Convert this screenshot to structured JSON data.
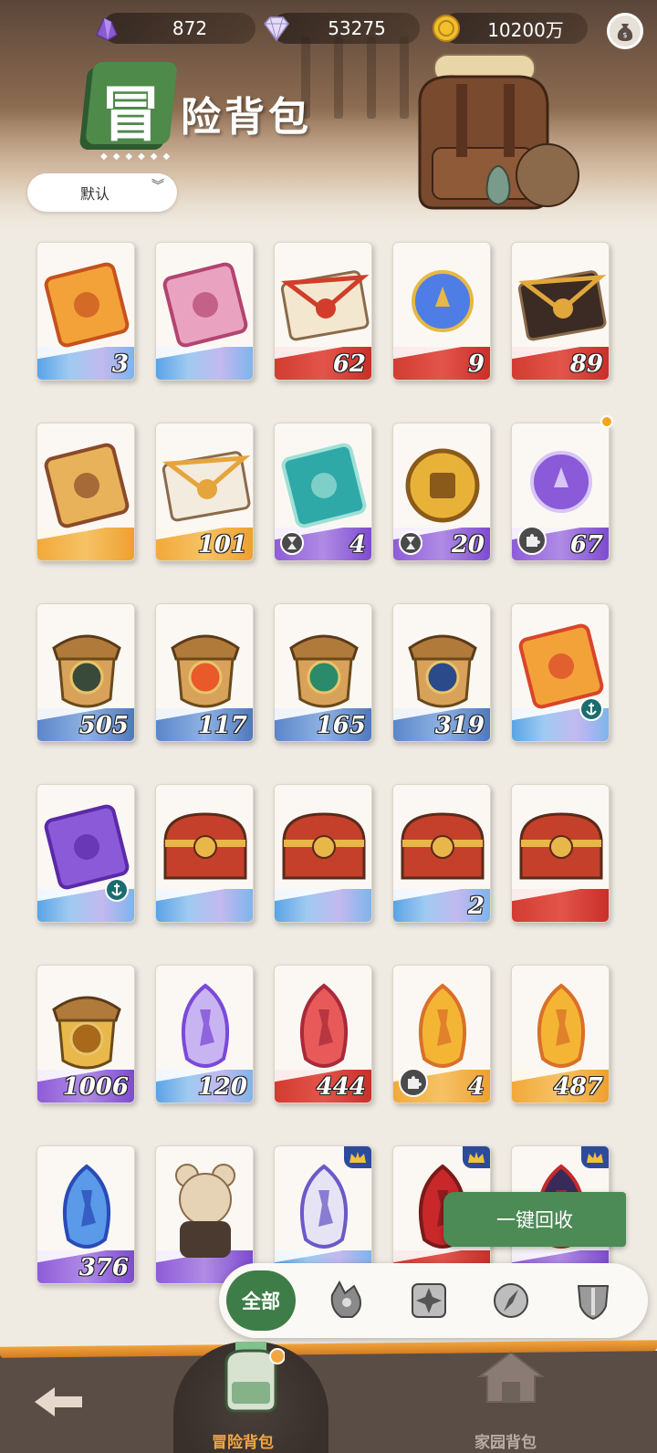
{
  "currencies": [
    {
      "name": "purple-crystal",
      "value": "872"
    },
    {
      "name": "diamond",
      "value": "53275"
    },
    {
      "name": "gold-coin",
      "value": "10200万"
    }
  ],
  "title": {
    "first_char": "冒",
    "rest": "险背包"
  },
  "sort": {
    "label": "默认"
  },
  "items": [
    {
      "count": "3",
      "bottom": "blue",
      "icon": "orange-ticket-icon"
    },
    {
      "count": "",
      "bottom": "blue",
      "icon": "pink-ticket-icon"
    },
    {
      "count": "62",
      "bottom": "red",
      "icon": "red-envelope-letter-icon"
    },
    {
      "count": "9",
      "bottom": "red",
      "icon": "crystal-orb-crown-icon"
    },
    {
      "count": "89",
      "bottom": "red",
      "icon": "dark-envelope-letter-icon"
    },
    {
      "count": "",
      "bottom": "gold",
      "icon": "hammer-plus-one-card-icon"
    },
    {
      "count": "101",
      "bottom": "gold",
      "icon": "white-envelope-letter-icon"
    },
    {
      "count": "4",
      "bottom": "purple",
      "icon": "teal-ticket-icon",
      "badge": "hourglass"
    },
    {
      "count": "20",
      "bottom": "purple",
      "icon": "gold-medal-coin-icon",
      "badge": "hourglass"
    },
    {
      "count": "67",
      "bottom": "purple",
      "icon": "purple-flame-trident-icon",
      "badge": "puzzle",
      "dot": true
    },
    {
      "count": "505",
      "bottom": "slate",
      "icon": "acorn-eye-emblem-icon"
    },
    {
      "count": "117",
      "bottom": "slate",
      "icon": "acorn-target-emblem-icon"
    },
    {
      "count": "165",
      "bottom": "slate",
      "icon": "acorn-leaf-emblem-icon"
    },
    {
      "count": "319",
      "bottom": "slate",
      "icon": "acorn-star-emblem-icon"
    },
    {
      "count": "",
      "bottom": "blue",
      "icon": "orange-helmet-card-icon",
      "anchor": true
    },
    {
      "count": "",
      "bottom": "blue",
      "icon": "purple-helmet-card-icon",
      "anchor": true
    },
    {
      "count": "",
      "bottom": "blue",
      "icon": "treasure-chest-icon"
    },
    {
      "count": "",
      "bottom": "blue",
      "icon": "treasure-chest-icon"
    },
    {
      "count": "2",
      "bottom": "blue",
      "icon": "treasure-chest-icon"
    },
    {
      "count": "",
      "bottom": "red",
      "icon": "treasure-chest-icon"
    },
    {
      "count": "1006",
      "bottom": "purple",
      "icon": "acorn-diamond-emblem-icon"
    },
    {
      "count": "120",
      "bottom": "blue",
      "icon": "rainbow-key-gem-icon"
    },
    {
      "count": "444",
      "bottom": "red",
      "icon": "red-key-gem-icon"
    },
    {
      "count": "4",
      "bottom": "gold",
      "icon": "gold-key-gem-icon",
      "badge": "puzzle"
    },
    {
      "count": "487",
      "bottom": "gold",
      "icon": "gold-key-gem-icon"
    },
    {
      "count": "376",
      "bottom": "purple",
      "icon": "blue-key-gem-icon"
    },
    {
      "count": "",
      "bottom": "purple",
      "icon": "mouse-character-figure-icon"
    },
    {
      "count": "",
      "bottom": "blue",
      "icon": "prism-gem-icon",
      "crown": true
    },
    {
      "count": "",
      "bottom": "red",
      "icon": "red-gem-icon",
      "crown": true
    },
    {
      "count": "",
      "bottom": "purple",
      "icon": "dark-gem-icon",
      "crown": true
    }
  ],
  "recycle_button": "一键回收",
  "filters": {
    "all": "全部",
    "icons": [
      "wolf-helmet-icon",
      "star-compass-icon",
      "compass-icon",
      "shield-sword-icon"
    ]
  },
  "nav": {
    "adventure_bag": "冒险背包",
    "home_bag": "家园背包"
  },
  "colors": {
    "accent_green": "#3f7d48",
    "nav_bg": "#5a4d46",
    "active_label": "#f2a642",
    "inactive_label": "#b8aca3"
  }
}
